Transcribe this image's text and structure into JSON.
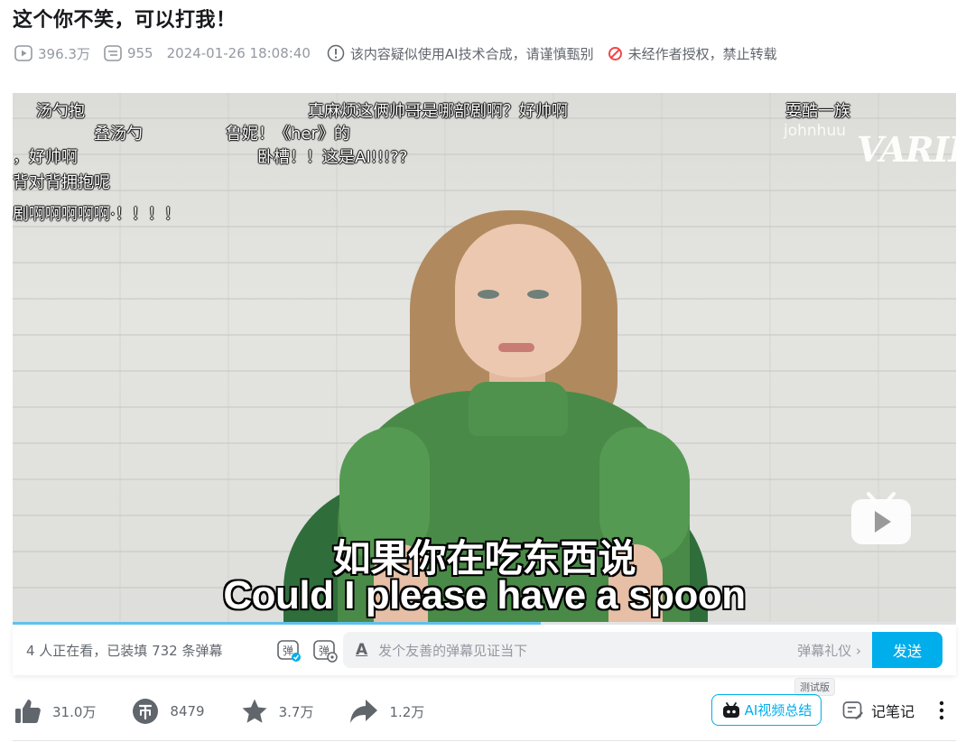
{
  "video": {
    "title": "这个你不笑，可以打我！",
    "views": "396.3万",
    "danmaku_count": "955",
    "publish_time": "2024-01-26 18:08:40",
    "ai_notice": "该内容疑似使用AI技术合成，请谨慎甄别",
    "copyright_notice": "未经作者授权，禁止转载"
  },
  "player": {
    "danmaku": [
      "汤勺抱",
      "真麻烦这俩帅哥是哪部剧啊？好帅啊",
      "耍酷一族",
      "叠汤勺",
      "鲁妮！《her》的",
      "，好帅啊",
      "卧槽！！这是AI!!!??",
      "背对背拥抱呢",
      "剧啊啊啊啊啊·！！！！"
    ],
    "watermark_user": "johnhuu",
    "watermark_logo": "VARIE",
    "subtitle_zh": "如果你在吃东西说",
    "subtitle_en": "Could I please have a spoon",
    "progress": 0.56
  },
  "danmaku_bar": {
    "viewers_text": "4 人正在看，已装填 732 条弹幕",
    "input_icon": "A",
    "placeholder": "发个友善的弹幕见证当下",
    "etiquette": "弹幕礼仪 ›",
    "send_label": "发送"
  },
  "toolbar": {
    "like_count": "31.0万",
    "coin_count": "8479",
    "favorite_count": "3.7万",
    "share_count": "1.2万",
    "ai_summary_label": "AI视频总结",
    "beta_badge": "测试版",
    "notes_label": "记笔记"
  },
  "colors": {
    "accent": "#00aeec",
    "warning_red": "#f2474a",
    "text_secondary": "#9499a0"
  }
}
